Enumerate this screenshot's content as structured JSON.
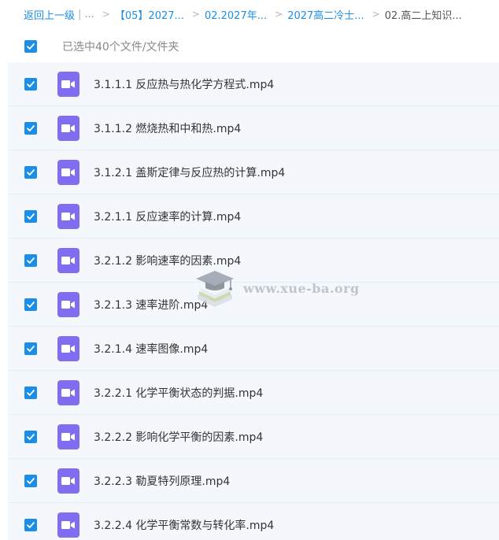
{
  "breadcrumb": {
    "back_label": "返回上一级",
    "sep": "|",
    "ellipsis": "...",
    "chevron": ">",
    "crumbs": [
      "【05】2027...",
      "02.2027年...",
      "2027高二冷士...",
      "02.高二上知识..."
    ]
  },
  "selection": {
    "text": "已选中40个文件/文件夹",
    "checked": true
  },
  "files": [
    {
      "name": "3.1.1.1 反应热与热化学方程式.mp4",
      "checked": true
    },
    {
      "name": "3.1.1.2 燃烧热和中和热.mp4",
      "checked": true
    },
    {
      "name": "3.1.2.1 盖斯定律与反应热的计算.mp4",
      "checked": true
    },
    {
      "name": "3.2.1.1 反应速率的计算.mp4",
      "checked": true
    },
    {
      "name": "3.2.1.2 影响速率的因素.mp4",
      "checked": true
    },
    {
      "name": "3.2.1.3 速率进阶.mp4",
      "checked": true
    },
    {
      "name": "3.2.1.4 速率图像.mp4",
      "checked": true
    },
    {
      "name": "3.2.2.1 化学平衡状态的判据.mp4",
      "checked": true
    },
    {
      "name": "3.2.2.2 影响化学平衡的因素.mp4",
      "checked": true
    },
    {
      "name": "3.2.2.3 勒夏特列原理.mp4",
      "checked": true
    },
    {
      "name": "3.2.2.4 化学平衡常数与转化率.mp4",
      "checked": true
    }
  ],
  "watermark": {
    "text": "www.xue-ba.org"
  },
  "colors": {
    "accent": "#1a8ee8",
    "video_icon": "#7f6ef0",
    "row_bg": "#f4f8fd"
  },
  "icons": {
    "checkbox": "checkmark-icon",
    "file": "video-file-icon"
  }
}
